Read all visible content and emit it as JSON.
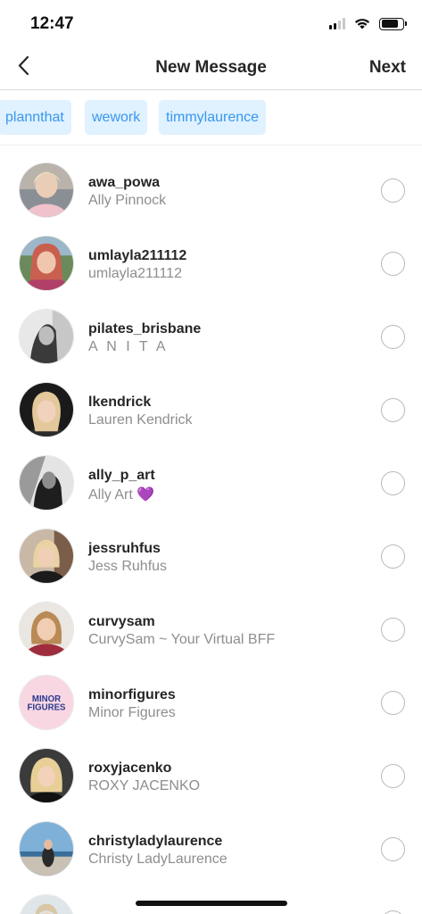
{
  "status_bar": {
    "time": "12:47"
  },
  "nav": {
    "title": "New Message",
    "next_label": "Next"
  },
  "chips": [
    {
      "label": "plannthat"
    },
    {
      "label": "wework"
    },
    {
      "label": "timmylaurence"
    }
  ],
  "contacts": [
    {
      "username": "awa_powa",
      "name": "Ally Pinnock"
    },
    {
      "username": "umlayla211112",
      "name": "umlayla211112"
    },
    {
      "username": "pilates_brisbane",
      "name": "A N I T A"
    },
    {
      "username": "lkendrick",
      "name": "Lauren Kendrick"
    },
    {
      "username": "ally_p_art",
      "name": "Ally Art 💜"
    },
    {
      "username": "jessruhfus",
      "name": "Jess Ruhfus"
    },
    {
      "username": "curvysam",
      "name": "CurvySam ~ Your Virtual BFF"
    },
    {
      "username": "minorfigures",
      "name": "Minor Figures",
      "logo_text_1": "MINOR",
      "logo_text_2": "FIGURES"
    },
    {
      "username": "roxyjacenko",
      "name": "ROXY JACENKO"
    },
    {
      "username": "christyladylaurence",
      "name": "Christy LadyLaurence"
    }
  ],
  "colors": {
    "chip_bg": "#e0f1ff",
    "chip_text": "#3897f0",
    "muted_text": "#8e8e8e",
    "minor_figures_bg": "#f8d7e3",
    "minor_figures_text": "#2b3a8f"
  }
}
